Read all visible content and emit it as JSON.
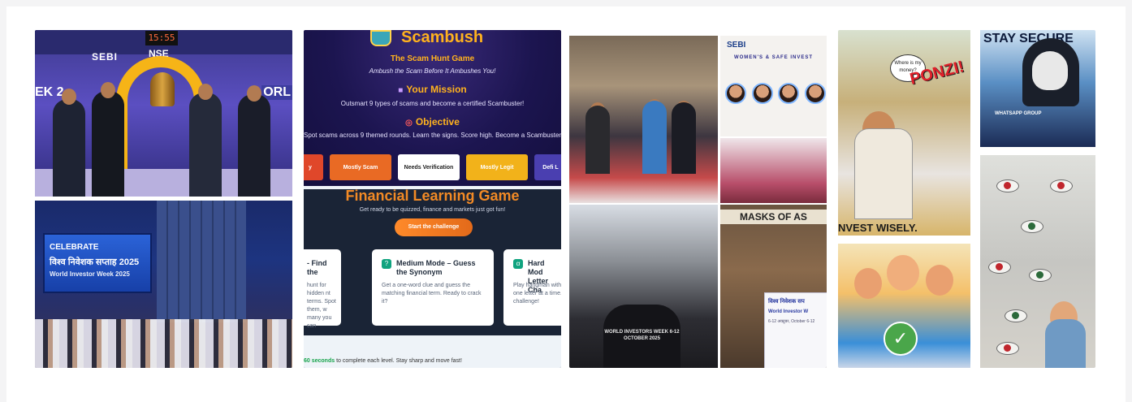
{
  "card1": {
    "top": {
      "clock": "15:55",
      "sebi": "SEBI",
      "nse": "NSE",
      "week_left": "EK 2",
      "week_right": "ORL"
    },
    "bottom": {
      "screen_line1": "CELEBRATE",
      "screen_line2": "विश्व निवेशक सप्ताह 2025",
      "screen_line3": "World Investor Week 2025"
    }
  },
  "card2": {
    "title": "Scambush",
    "subtitle": "The Scam Hunt Game",
    "tagline": "Ambush the Scam Before It Ambushes You!",
    "mission": {
      "heading": "Your Mission",
      "text": "Outsmart 9 types of scams and become a certified Scambuster!"
    },
    "objective": {
      "heading": "Objective",
      "text": "Spot scams across 9 themed rounds. Learn the signs. Score high. Become a Scambuster."
    },
    "verdicts": [
      {
        "label": "y",
        "color": "#e0472a"
      },
      {
        "label": "Mostly Scam",
        "color": "#e96a24"
      },
      {
        "label": "Needs Verification",
        "color": "#ffffff"
      },
      {
        "label": "Mostly Legit",
        "color": "#f2b21a"
      },
      {
        "label": "Defi L",
        "color": "#4a3fb0"
      }
    ],
    "learning": {
      "title": "Financial Learning Game",
      "subtitle": "Get ready to be quizzed, finance and markets just got fun!",
      "button": "Start the challenge"
    },
    "modes": [
      {
        "title": "- Find the",
        "desc": "hunt for hidden nt terms. Spot them, w many you can"
      },
      {
        "icon": "?",
        "title": "Medium Mode – Guess the Synonym",
        "desc": "Get a one-word clue and guess the matching financial term. Ready to crack it?"
      },
      {
        "icon": "ꭤ",
        "title": "Hard Mod Letter Cha",
        "desc": "Play hangman with one letter at a time. challenge!"
      }
    ],
    "footer_seconds": "60 seconds",
    "footer_text": " to complete each level. Stay sharp and move fast!"
  },
  "card3": {
    "panel2": {
      "logo": "SEBI",
      "title": "WOMEN'S & SAFE INVEST"
    },
    "tee_text": "WORLD INVESTORS WEEK 6-12 OCTOBER 2025",
    "masks": "MASKS OF AS",
    "board": {
      "hindi": "विश्व निवेशक सप",
      "english": "World Investor W",
      "dates": "6-12 अक्टूबर, October 6-12"
    }
  },
  "card4": {
    "poster1": {
      "ponzi": "PONZI!",
      "invest": "NVEST WISELY.",
      "bubble": "Where is my money?"
    },
    "poster2": {
      "stay": "STAY SECURE",
      "bubble": "WHATSAPP GROUP"
    }
  }
}
